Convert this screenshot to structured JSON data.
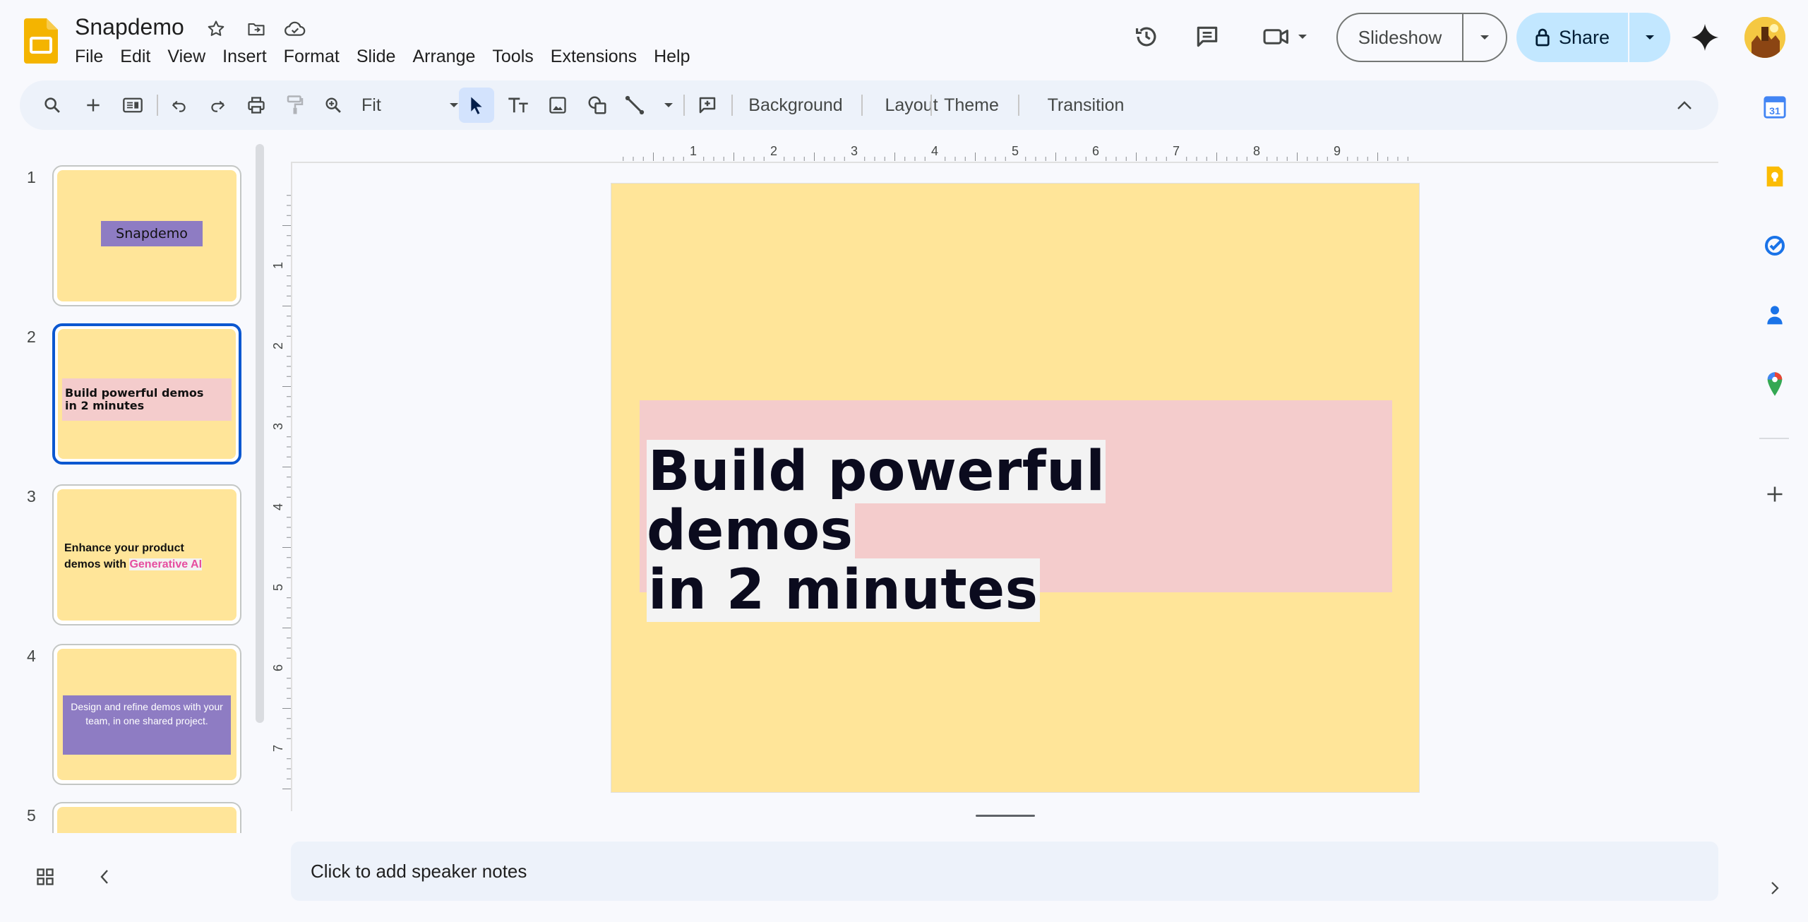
{
  "app": {
    "title": "Snapdemo",
    "icon": "slides-app-icon"
  },
  "menu": [
    "File",
    "Edit",
    "View",
    "Insert",
    "Format",
    "Slide",
    "Arrange",
    "Tools",
    "Extensions",
    "Help"
  ],
  "header": {
    "slideshow_label": "Slideshow",
    "share_label": "Share"
  },
  "toolbar": {
    "zoom_value": "Fit",
    "background_label": "Background",
    "layout_label": "Layout",
    "theme_label": "Theme",
    "transition_label": "Transition"
  },
  "rulers": {
    "horizontal": [
      "1",
      "2",
      "3",
      "4",
      "5",
      "6",
      "7",
      "8",
      "9"
    ],
    "vertical": [
      "1",
      "2",
      "3",
      "4",
      "5",
      "6",
      "7"
    ]
  },
  "slides": [
    {
      "number": "1",
      "title": "Snapdemo"
    },
    {
      "number": "2",
      "line1": "Build powerful demos",
      "line2": "in 2 minutes"
    },
    {
      "number": "3",
      "line1": "Enhance your product",
      "line2_prefix": "demos with ",
      "line2_highlight": "Generative AI"
    },
    {
      "number": "4",
      "line1": "Design and refine demos with your",
      "line2": "team, in one shared project."
    },
    {
      "number": "5"
    }
  ],
  "current_slide": {
    "line1": "Build powerful demos",
    "line2": "in 2 minutes"
  },
  "notes": {
    "placeholder": "Click to add speaker notes"
  },
  "colors": {
    "slide_background": "#ffe599",
    "title_box": "#f4cccc",
    "purple_box": "#8e7cc3",
    "accent_blue": "#0b57d0",
    "share_button": "#c2e7ff",
    "generative_ai_pink": "#e64ea0"
  }
}
